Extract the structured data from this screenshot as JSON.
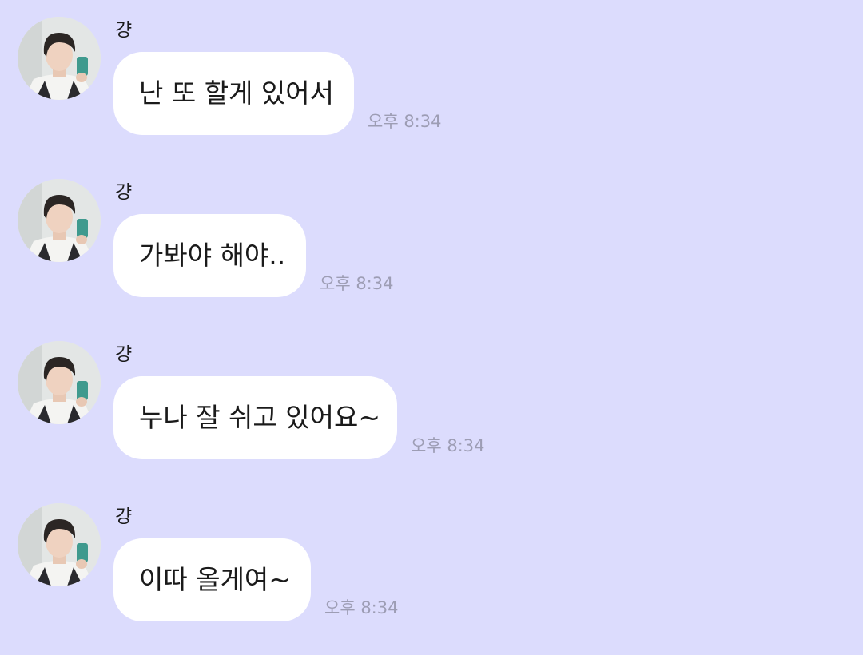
{
  "chat": {
    "messages": [
      {
        "sender": "걍",
        "text": "난 또 할게 있어서",
        "time": "오후 8:34"
      },
      {
        "sender": "걍",
        "text": "가봐야 해야..",
        "time": "오후 8:34"
      },
      {
        "sender": "걍",
        "text": "누나 잘 쉬고 있어요~",
        "time": "오후 8:34"
      },
      {
        "sender": "걍",
        "text": "이따 올게여~",
        "time": "오후 8:34"
      }
    ]
  },
  "colors": {
    "background": "#dcdcfd",
    "bubble": "#ffffff",
    "timestamp": "#9d9db4",
    "text": "#1a1a1a"
  },
  "icons": {
    "avatar": "profile-photo-avatar"
  }
}
